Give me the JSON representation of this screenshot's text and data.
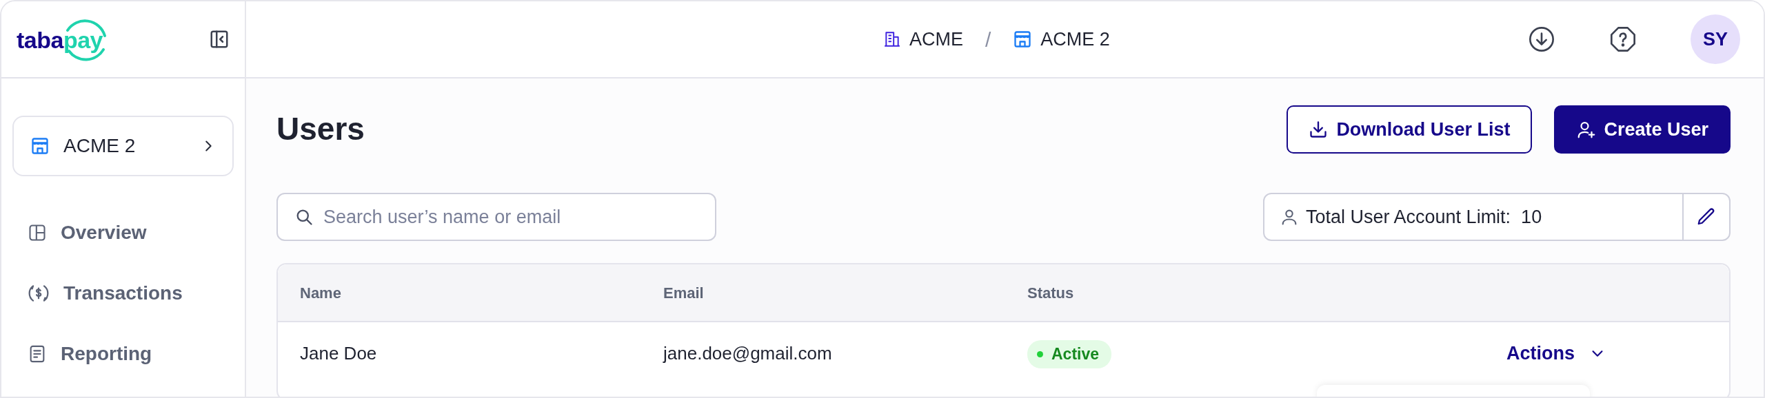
{
  "logo": {
    "part_1": "taba",
    "part_2": "pay"
  },
  "breadcrumb": [
    {
      "label": "ACME",
      "kind": "company"
    },
    {
      "label": "ACME 2",
      "kind": "store"
    }
  ],
  "breadcrumb_separator": "/",
  "avatar": {
    "initials": "SY"
  },
  "sidebar": {
    "org": {
      "label": "ACME 2"
    },
    "items": [
      {
        "label": "Overview",
        "kind": "overview",
        "selected": false
      },
      {
        "label": "Transactions",
        "kind": "transactions",
        "selected": false
      },
      {
        "label": "Reporting",
        "kind": "reporting",
        "selected": false
      }
    ]
  },
  "page": {
    "title": "Users",
    "buttons": [
      {
        "label": "Download User List",
        "kind": "outline"
      },
      {
        "label": "Create User",
        "kind": "primary"
      }
    ]
  },
  "search": {
    "placeholder": "Search user’s name or email"
  },
  "limit": {
    "label": "Total User Account Limit:",
    "value": "10"
  },
  "table": {
    "columns": [
      "Name",
      "Email",
      "Status"
    ],
    "rows": [
      {
        "name": "Jane Doe",
        "email": "jane.doe@gmail.com",
        "status": "Active",
        "color": "#22d13a",
        "action": "Actions"
      }
    ]
  }
}
